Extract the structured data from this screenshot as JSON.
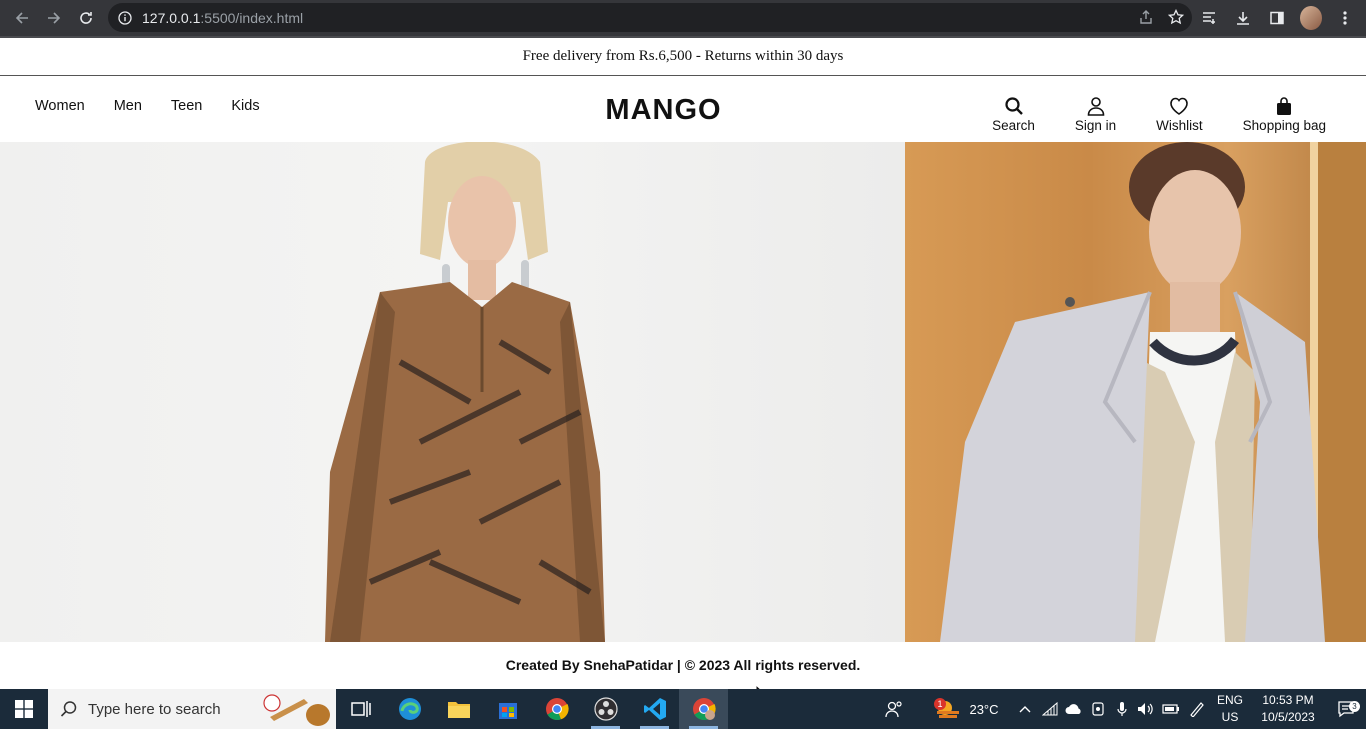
{
  "browser": {
    "url_host": "127.0.0.1",
    "url_rest": ":5500/index.html"
  },
  "announcement": "Free delivery from Rs.6,500 - Returns within 30 days",
  "header": {
    "nav": [
      "Women",
      "Men",
      "Teen",
      "Kids"
    ],
    "logo": "MANGO",
    "actions": {
      "search": "Search",
      "sign_in": "Sign in",
      "wishlist": "Wishlist",
      "bag": "Shopping bag"
    }
  },
  "footer": "Created By SnehaPatidar | © 2023 All rights reserved.",
  "taskbar": {
    "search_placeholder": "Type here to search",
    "weather_temp": "23°C",
    "weather_badge": "1",
    "lang_top": "ENG",
    "lang_bottom": "US",
    "time": "10:53 PM",
    "date": "10/5/2023",
    "notifications": "3"
  }
}
